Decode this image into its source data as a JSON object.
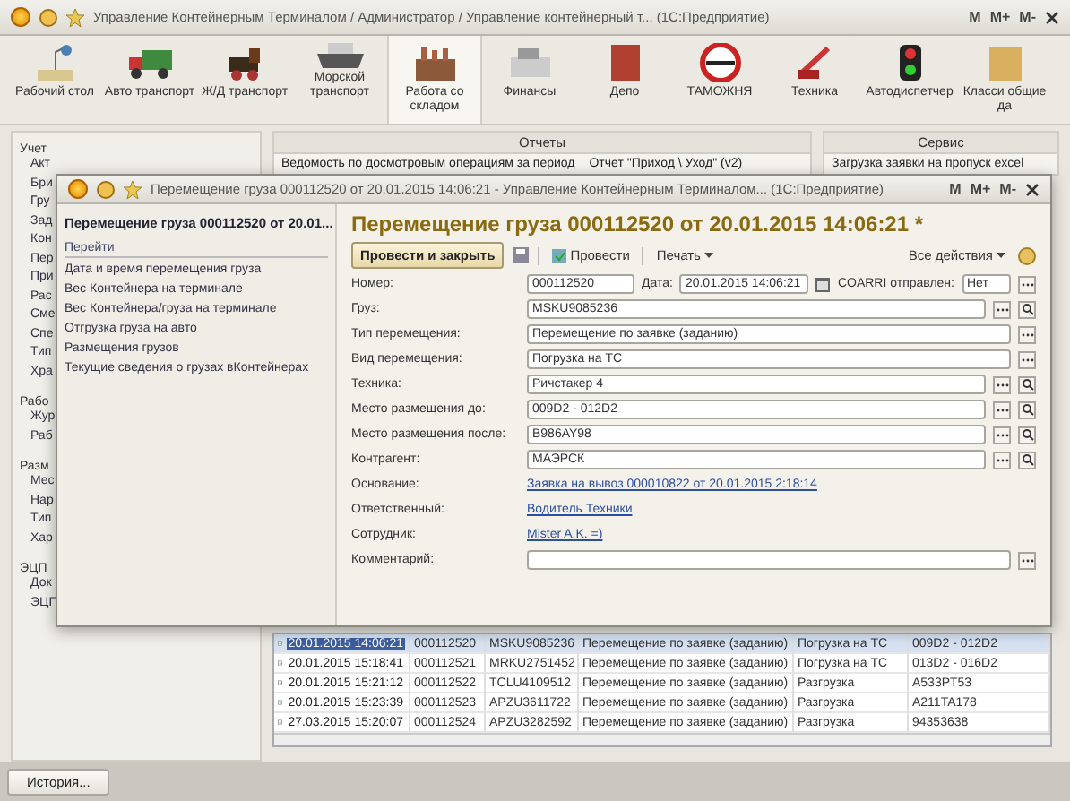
{
  "window": {
    "title": "Управление Контейнерным Терминалом / Администратор / Управление контейнерный т...  (1С:Предприятие)",
    "memory_buttons": [
      "M",
      "M+",
      "M-"
    ]
  },
  "sections": [
    {
      "label": "Рабочий стол",
      "selected": false
    },
    {
      "label": "Авто транспорт",
      "selected": false
    },
    {
      "label": "Ж/Д транспорт",
      "selected": false
    },
    {
      "label": "Морской транспорт",
      "selected": false
    },
    {
      "label": "Работа со складом",
      "selected": true
    },
    {
      "label": "Финансы",
      "selected": false
    },
    {
      "label": "Депо",
      "selected": false
    },
    {
      "label": "ТАМОЖНЯ",
      "selected": false
    },
    {
      "label": "Техника",
      "selected": false
    },
    {
      "label": "Автодиспетчер",
      "selected": false
    },
    {
      "label": "Класси общие да",
      "selected": false
    }
  ],
  "sidebar": {
    "groups": [
      {
        "title": "Учет",
        "items": [
          "Акт",
          "Бри",
          "Гру",
          "Зад",
          "Кон",
          "Пер",
          "При",
          "Рас",
          "Сме",
          "Спе",
          "Тип",
          "Хра"
        ]
      },
      {
        "title": "Рабо",
        "items": [
          "Жур",
          "Раб"
        ]
      },
      {
        "title": "Разм",
        "items": [
          "Мес",
          "Нар",
          "Тип",
          "Хар"
        ]
      },
      {
        "title": "ЭЦП",
        "items": [
          "Док",
          "ЭЦП"
        ]
      }
    ]
  },
  "panels": [
    {
      "title": "Отчеты",
      "items": [
        "Ведомость по досмотровым операциям за период",
        "Отчет \"Приход \\ Уход\" (v2)"
      ]
    },
    {
      "title": "Сервис",
      "items": [
        "Загрузка заявки на пропуск excel"
      ]
    }
  ],
  "table": {
    "rows": [
      {
        "date": "20.01.2015 14:06:21",
        "number": "000112520",
        "container": "MSKU9085236",
        "type": "Перемещение по заявке (заданию)",
        "kind": "Погрузка на ТС",
        "place": "009D2 - 012D2",
        "selected": true
      },
      {
        "date": "20.01.2015 15:18:41",
        "number": "000112521",
        "container": "MRKU2751452",
        "type": "Перемещение по заявке (заданию)",
        "kind": "Погрузка на ТС",
        "place": "013D2 - 016D2",
        "selected": false
      },
      {
        "date": "20.01.2015 15:21:12",
        "number": "000112522",
        "container": "TCLU4109512",
        "type": "Перемещение по заявке (заданию)",
        "kind": "Разгрузка",
        "place": "A533PT53",
        "selected": false
      },
      {
        "date": "20.01.2015 15:23:39",
        "number": "000112523",
        "container": "APZU3611722",
        "type": "Перемещение по заявке (заданию)",
        "kind": "Разгрузка",
        "place": "A211TA178",
        "selected": false
      },
      {
        "date": "27.03.2015 15:20:07",
        "number": "000112524",
        "container": "APZU3282592",
        "type": "Перемещение по заявке (заданию)",
        "kind": "Разгрузка",
        "place": "94353638",
        "selected": false
      }
    ]
  },
  "history_button": "История...",
  "dialog": {
    "title": "Перемещение груза 000112520 от 20.01.2015 14:06:21 - Управление Контейнерным Терминалом...  (1С:Предприятие)",
    "memory_buttons": [
      "M",
      "M+",
      "M-"
    ],
    "nav_title": "Перемещение груза 000112520 от 20.01...",
    "nav_heading": "Перейти",
    "nav_items": [
      "Дата и время перемещения груза",
      "Вес Контейнера на терминале",
      "Вес Контейнера/груза на терминале",
      "Отгрузка груза на авто",
      "Размещения грузов",
      "Текущие сведения о грузах вКонтейнерах"
    ],
    "heading": "Перемещение груза 000112520 от 20.01.2015 14:06:21 *",
    "toolbar": {
      "post_close": "Провести и закрыть",
      "post": "Провести",
      "print": "Печать",
      "all_actions": "Все действия"
    },
    "header": {
      "number_label": "Номер:",
      "number": "000112520",
      "date_label": "Дата:",
      "date": "20.01.2015 14:06:21",
      "coarri_label": "COARRI отправлен:",
      "coarri": "Нет"
    },
    "fields": [
      {
        "kind": "field",
        "label": "Груз:",
        "value": "MSKU9085236",
        "open": true
      },
      {
        "kind": "field",
        "label": "Тип перемещения:",
        "value": "Перемещение по заявке (заданию)",
        "open": false
      },
      {
        "kind": "field",
        "label": "Вид перемещения:",
        "value": "Погрузка на ТС",
        "open": false
      },
      {
        "kind": "field",
        "label": "Техника:",
        "value": "Ричстакер 4",
        "open": true
      },
      {
        "kind": "field",
        "label": "Место размещения до:",
        "value": "009D2 - 012D2",
        "open": true
      },
      {
        "kind": "field",
        "label": "Место размещения после:",
        "value": "B986AY98",
        "open": true
      },
      {
        "kind": "field",
        "label": "Контрагент:",
        "value": "МАЭРСК",
        "open": true
      },
      {
        "kind": "link",
        "label": "Основание:",
        "value": "Заявка на вывоз 000010822 от 20.01.2015 2:18:14"
      },
      {
        "kind": "link",
        "label": "Ответственный:",
        "value": "Водитель Техники"
      },
      {
        "kind": "link",
        "label": "Сотрудник:",
        "value": "Mister A.K. =)"
      },
      {
        "kind": "field",
        "label": "Комментарий:",
        "open": false
      }
    ]
  }
}
